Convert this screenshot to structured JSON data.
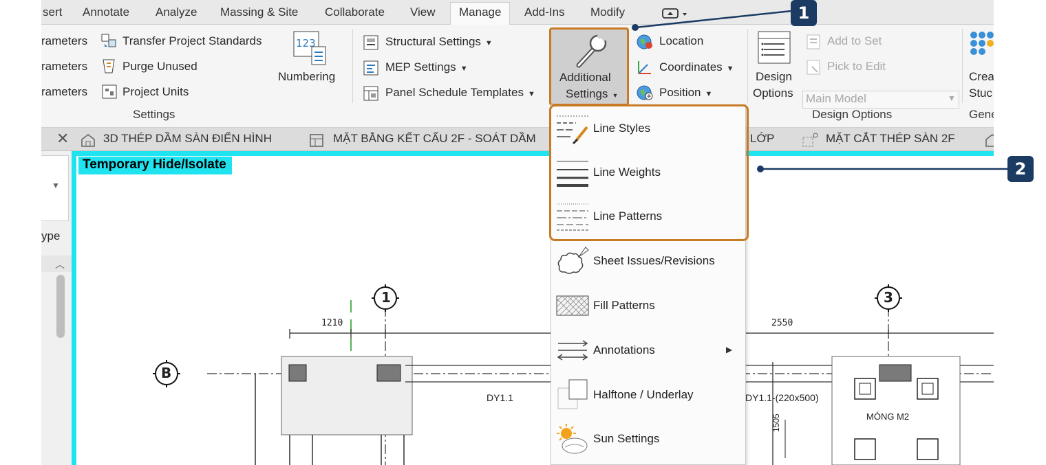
{
  "ribbon_tabs": [
    "sert",
    "Annotate",
    "Analyze",
    "Massing & Site",
    "Collaborate",
    "View",
    "Manage",
    "Add-Ins",
    "Modify"
  ],
  "active_tab": "Manage",
  "settings_panel": {
    "params": [
      "rameters",
      "rameters",
      "rameters"
    ],
    "transfer": "Transfer  Project Standards",
    "purge": "Purge  Unused",
    "units": "Project  Units",
    "numbering": "Numbering",
    "numbering_icon_text": "123",
    "structural": "Structural  Settings",
    "mep": "MEP  Settings",
    "panel_schedule": "Panel Schedule  Templates",
    "additional_line1": "Additional",
    "additional_line2": "Settings",
    "label": "Settings"
  },
  "location_panel": {
    "location": "Location",
    "coordinates": "Coordinates",
    "position": "Position"
  },
  "design_options_panel": {
    "design_line1": "Design",
    "design_line2": "Options",
    "add_to_set": "Add to Set",
    "pick_to_edit": "Pick to Edit",
    "main_model": "Main Model",
    "label": "Design Options"
  },
  "generate_panel": {
    "create_line1": "Crea",
    "create_line2": "Stuc",
    "label": "Gene"
  },
  "view_tabs": [
    "3D THÉP DẦM SÀN ĐIỂN HÌNH",
    "MẶT BẰNG KẾT CẤU 2F - SOÁT DẦM",
    "LỚP",
    "MẶT CẮT THÉP SÀN 2F"
  ],
  "left_panel": {
    "type_text": "ype"
  },
  "canvas": {
    "temporary_label": "Temporary Hide/Isolate",
    "grid_1": "1",
    "grid_3": "3",
    "grid_b": "B",
    "dim_1210": "1210",
    "dim_2550": "2550",
    "beam_1": "DY1.1",
    "beam_2": "DY1.1-(220x500)",
    "footing": "MÓNG M2",
    "dim_1505": "1505"
  },
  "menu_items": [
    "Line Styles",
    "Line Weights",
    "Line Patterns",
    "Sheet Issues/Revisions",
    "Fill Patterns",
    "Annotations",
    "Halftone / Underlay",
    "Sun Settings"
  ],
  "callouts": [
    "1",
    "2"
  ],
  "colors": {
    "highlight": "#c97a25",
    "isolate_cyan": "#1fe3ef",
    "callout_bg": "#1b3b63"
  }
}
